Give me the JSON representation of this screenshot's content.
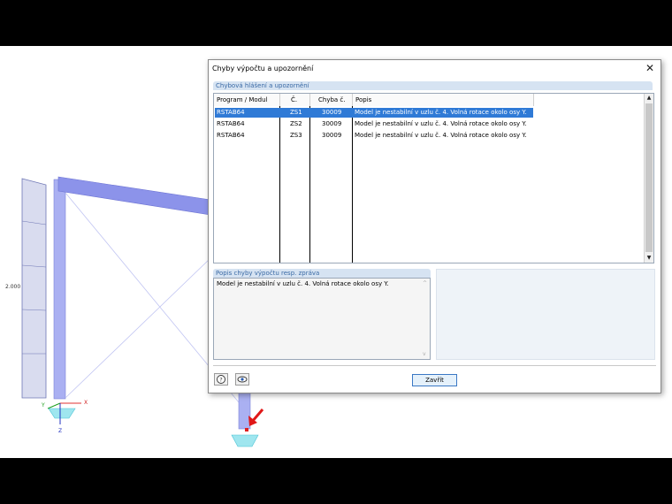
{
  "scene": {
    "load_value": "2.000",
    "axes": {
      "x": "X",
      "y": "Y",
      "z": "Z"
    }
  },
  "dialog": {
    "title": "Chyby výpočtu a upozornění",
    "close_glyph": "✕",
    "errors_group_title": "Chybová hlášení a upozornění",
    "columns": [
      "Program / Modul",
      "Č.",
      "Chyba č.",
      "Popis"
    ],
    "rows": [
      {
        "program": "RSTAB64",
        "number": "ZS1",
        "error": "30009",
        "description": "Model je nestabilní v uzlu č. 4. Volná rotace okolo osy Y.",
        "selected": true
      },
      {
        "program": "RSTAB64",
        "number": "ZS2",
        "error": "30009",
        "description": "Model je nestabilní v uzlu č. 4. Volná rotace okolo osy Y.",
        "selected": false
      },
      {
        "program": "RSTAB64",
        "number": "ZS3",
        "error": "30009",
        "description": "Model je nestabilní v uzlu č. 4. Volná rotace okolo osy Y.",
        "selected": false
      }
    ],
    "desc_group_title": "Popis chyby výpočtu resp. zpráva",
    "desc_text": "Model je nestabilní v uzlu č. 4. Volná rotace okolo osy Y.",
    "close_button": "Zavřít",
    "help_icon": "help-icon",
    "view_icon": "eye-icon"
  }
}
